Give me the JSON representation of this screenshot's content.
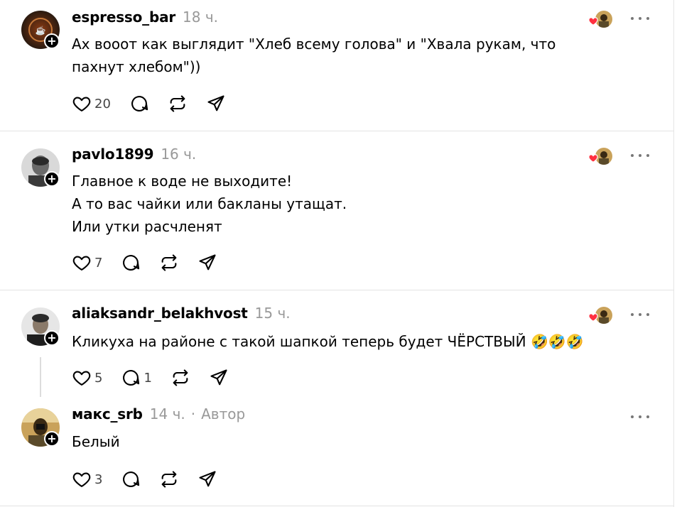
{
  "comments": [
    {
      "username": "espresso_bar",
      "time": "18 ч.",
      "lines": [
        "Ах вооот как выглядит \"Хлеб всему голова\" и \"Хвала рукам, что",
        "пахнут хлебом\"))"
      ],
      "likes": "20",
      "replies": "",
      "liked_by_author": true,
      "avatar_colors": [
        "#2a1a10",
        "#8a3a12"
      ]
    },
    {
      "username": "pavlo1899",
      "time": "16 ч.",
      "lines": [
        "Главное к воде не выходите!",
        "А то вас чайки или бакланы утащат.",
        "Или утки расчленят"
      ],
      "likes": "7",
      "replies": "",
      "liked_by_author": true,
      "avatar_colors": [
        "#d9d9d9",
        "#4a4a4a"
      ]
    },
    {
      "username": "aliaksandr_belakhvost",
      "time": "15 ч.",
      "lines": [
        "Кликуха на районе с такой шапкой теперь будет ЧЁРСТВЫЙ"
      ],
      "emojis": "🤣🤣🤣",
      "likes": "5",
      "replies": "1",
      "liked_by_author": true,
      "avatar_colors": [
        "#e6e6e6",
        "#2b2b2b"
      ]
    },
    {
      "username": "макс_srb",
      "time": "14 ч.",
      "separator": "·",
      "author_label": "Автор",
      "lines": [
        "Белый"
      ],
      "likes": "3",
      "replies": "",
      "liked_by_author": false,
      "avatar_colors": [
        "#c9a25a",
        "#3a2a14"
      ]
    }
  ],
  "colors": {
    "heart_red": "#ff3040",
    "muted": "#999999",
    "divider": "#e3e3e3"
  },
  "icons": {
    "like": "heart-outline-icon",
    "reply": "speech-bubble-icon",
    "repost": "repost-icon",
    "share": "send-paper-plane-icon",
    "more": "ellipsis-icon",
    "follow": "plus-icon"
  }
}
